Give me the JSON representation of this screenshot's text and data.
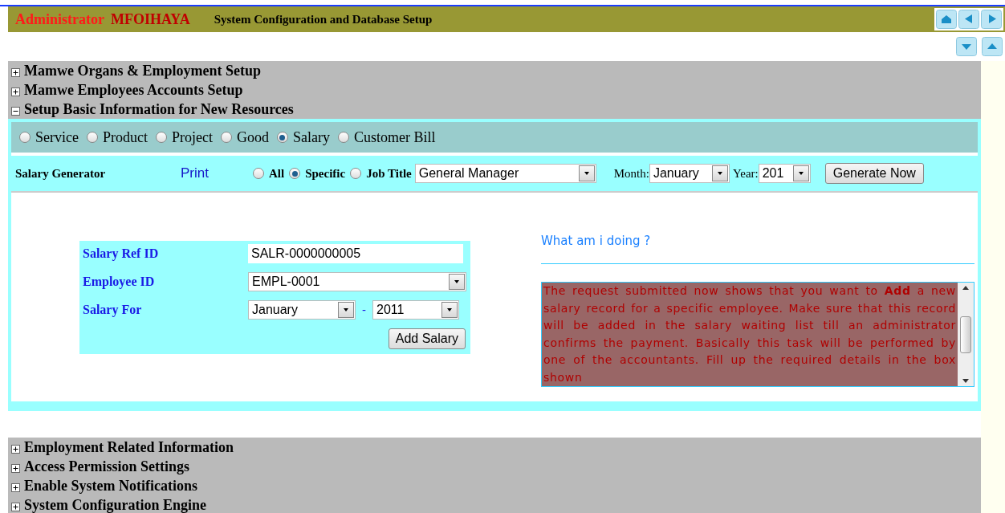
{
  "header": {
    "role": "Administrator",
    "user": "MFOIHAYA",
    "title": "System Configuration and Database Setup"
  },
  "sections": [
    {
      "title": "Mamwe Organs & Employment Setup",
      "expanded": false
    },
    {
      "title": "Mamwe Employees Accounts Setup",
      "expanded": false
    },
    {
      "title": "Setup Basic Information for New Resources",
      "expanded": true
    },
    {
      "title": "Employment Related Information",
      "expanded": false
    },
    {
      "title": "Access Permission Settings",
      "expanded": false
    },
    {
      "title": "Enable System Notifications",
      "expanded": false
    },
    {
      "title": "System Configuration Engine",
      "expanded": false
    }
  ],
  "resource_types": [
    {
      "label": "Service",
      "selected": false
    },
    {
      "label": "Product",
      "selected": false
    },
    {
      "label": "Project",
      "selected": false
    },
    {
      "label": "Good",
      "selected": false
    },
    {
      "label": "Salary",
      "selected": true
    },
    {
      "label": "Customer Bill",
      "selected": false
    }
  ],
  "generator": {
    "title": "Salary Generator",
    "print_link": "Print",
    "scopes": [
      {
        "label": "All",
        "selected": false
      },
      {
        "label": "Specific",
        "selected": true
      },
      {
        "label": "Job Title",
        "selected": false
      }
    ],
    "job_title": "General Manager",
    "month_label": "Month:",
    "month": "January",
    "year_label": "Year:",
    "year": "201",
    "button": "Generate Now"
  },
  "form": {
    "fields": [
      {
        "kind": "text",
        "label": "Salary Ref ID",
        "value": "SALR-0000000005"
      },
      {
        "kind": "select",
        "label": "Employee ID",
        "value": "EMPL-0001"
      },
      {
        "kind": "period",
        "label": "Salary For",
        "month": "January",
        "separator": "-",
        "year": "2011"
      }
    ],
    "button": "Add Salary"
  },
  "help": {
    "heading": "What am i doing ?",
    "text": "The request submitted now shows that you want to **Add** a new salary record for a specific employee. Make sure that this record will be added in the salary waiting list till an administrator confirms the payment. Basically this task will be performed by one of the accountants. Fill up the required details in the box shown"
  }
}
